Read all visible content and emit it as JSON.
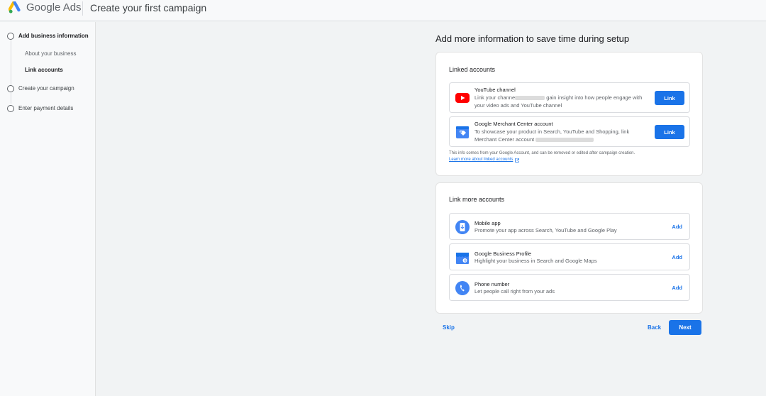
{
  "header": {
    "brand": "Google Ads",
    "page_title": "Create your first campaign"
  },
  "sidebar": {
    "steps": [
      {
        "label": "Add business information",
        "substeps": [
          {
            "label": "About your business"
          },
          {
            "label": "Link accounts"
          }
        ]
      },
      {
        "label": "Create your campaign"
      },
      {
        "label": "Enter payment details"
      }
    ]
  },
  "main": {
    "title": "Add more information to save time during setup",
    "linked_accounts": {
      "title": "Linked accounts",
      "items": [
        {
          "title": "YouTube channel",
          "desc_part1": "Link your channe",
          "desc_part2": " gain insight into how people engage with your video ads and YouTube channel",
          "action": "Link",
          "icon": "youtube-icon"
        },
        {
          "title": "Google Merchant Center account",
          "desc_part1": "To showcase your product in Search, YouTube and Shopping, link Merchant Center account",
          "action": "Link",
          "icon": "merchant-center-icon"
        }
      ],
      "info": "This info comes from your Google Account, and can be removed or edited after campaign creation.",
      "learn_more": "Learn more about linked accounts"
    },
    "more_accounts": {
      "title": "Link more accounts",
      "items": [
        {
          "title": "Mobile app",
          "desc": "Promote your app across Search, YouTube and Google Play",
          "action": "Add",
          "icon": "mobile-app-icon"
        },
        {
          "title": "Google Business Profile",
          "desc": "Highlight your business in Search and Google Maps",
          "action": "Add",
          "icon": "business-profile-icon"
        },
        {
          "title": "Phone number",
          "desc": "Let people call right from your ads",
          "action": "Add",
          "icon": "phone-icon"
        }
      ]
    }
  },
  "footer": {
    "skip": "Skip",
    "back": "Back",
    "next": "Next"
  },
  "colors": {
    "accent": "#1a73e8",
    "youtube_red": "#ff0000"
  }
}
